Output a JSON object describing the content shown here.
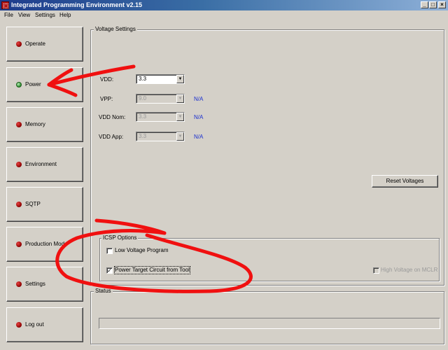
{
  "window": {
    "title": "Integrated Programming Environment v2.15"
  },
  "menu": [
    "File",
    "View",
    "Settings",
    "Help"
  ],
  "nav": [
    {
      "label": "Operate",
      "state": "inactive"
    },
    {
      "label": "Power",
      "state": "active"
    },
    {
      "label": "Memory",
      "state": "inactive"
    },
    {
      "label": "Environment",
      "state": "inactive"
    },
    {
      "label": "SQTP",
      "state": "inactive"
    },
    {
      "label": "Production Mode",
      "state": "inactive"
    },
    {
      "label": "Settings",
      "state": "inactive"
    },
    {
      "label": "Log out",
      "state": "inactive"
    }
  ],
  "voltage": {
    "title": "Voltage Settings",
    "vdd": {
      "label": "VDD:",
      "value": "3.3"
    },
    "vpp": {
      "label": "VPP:",
      "value": "9.0",
      "na": "N/A"
    },
    "vdd_nom": {
      "label": "VDD Nom:",
      "value": "3.3",
      "na": "N/A"
    },
    "vdd_app": {
      "label": "VDD App:",
      "value": "3.3",
      "na": "N/A"
    },
    "reset_button": "Reset Voltages"
  },
  "icsp": {
    "title": "ICSP Options",
    "low_voltage": {
      "label": "Low Voltage Program",
      "checked": false
    },
    "power_target": {
      "label": "Power Target Circuit from Tool",
      "checked": true
    },
    "high_voltage": {
      "label": "High Voltage on MCLR",
      "checked": false,
      "disabled": true
    }
  },
  "status": {
    "title": "Status"
  },
  "colors": {
    "annotation": "#f01010",
    "na_text": "#1a2fd0",
    "active_dot": "#2e8b2e",
    "inactive_dot": "#8a0000"
  },
  "icons": {
    "app": "chip-icon",
    "nav_indicator": "led-indicator-icon"
  }
}
